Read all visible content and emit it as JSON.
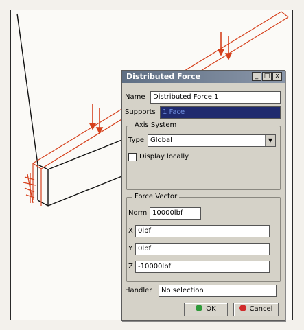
{
  "dialog": {
    "title": "Distributed Force",
    "name_label": "Name",
    "name_value": "Distributed Force.1",
    "supports_label": "Supports",
    "supports_value": "1 Face",
    "axis_group_title": "Axis System",
    "type_label": "Type",
    "type_value": "Global",
    "display_locally_label": "Display locally",
    "force_group_title": "Force Vector",
    "norm_label": "Norm",
    "norm_value": "10000lbf",
    "x_label": "X",
    "x_value": "0lbf",
    "y_label": "Y",
    "y_value": "0lbf",
    "z_label": "Z",
    "z_value": "-10000lbf",
    "handler_label": "Handler",
    "handler_value": "No selection",
    "ok_label": "OK",
    "cancel_label": "Cancel",
    "title_buttons": [
      "_",
      "□",
      "x"
    ]
  },
  "colors": {
    "force_arrow": "#d6401c",
    "selected_field_bg": "#1f2a6e",
    "ok_icon": "#2f9a3a",
    "cancel_icon": "#d02a2a"
  }
}
